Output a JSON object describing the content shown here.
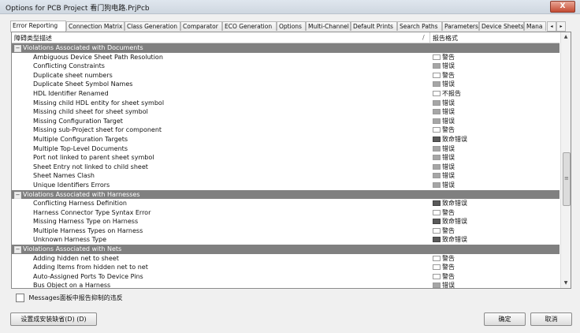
{
  "window": {
    "title": "Options for PCB Project 看门狗电路.PrjPcb",
    "close_label": "X"
  },
  "tabs": [
    "Error Reporting",
    "Connection Matrix",
    "Class Generation",
    "Comparator",
    "ECO Generation",
    "Options",
    "Multi-Channel",
    "Default Prints",
    "Search Paths",
    "Parameters",
    "Device Sheets",
    "Mana"
  ],
  "tab_scroll": {
    "left": "◂",
    "right": "▸"
  },
  "table": {
    "col1": "障碍类型描述",
    "sort_glyph": "/",
    "col2": "报告格式",
    "groups": [
      {
        "name": "Violations Associated with Documents",
        "expander": "−",
        "items": [
          {
            "label": "Ambiguous Device Sheet Path Resolution",
            "level": "警告",
            "kind": "warning"
          },
          {
            "label": "Conflicting Constraints",
            "level": "错误",
            "kind": "error"
          },
          {
            "label": "Duplicate sheet numbers",
            "level": "警告",
            "kind": "warning"
          },
          {
            "label": "Duplicate Sheet Symbol Names",
            "level": "错误",
            "kind": "error"
          },
          {
            "label": "HDL Identifier Renamed",
            "level": "不报告",
            "kind": "none"
          },
          {
            "label": "Missing child HDL entity for sheet symbol",
            "level": "错误",
            "kind": "error"
          },
          {
            "label": "Missing child sheet for sheet symbol",
            "level": "错误",
            "kind": "error"
          },
          {
            "label": "Missing Configuration Target",
            "level": "错误",
            "kind": "error"
          },
          {
            "label": "Missing sub-Project sheet for component",
            "level": "警告",
            "kind": "warning"
          },
          {
            "label": "Multiple Configuration Targets",
            "level": "致命错误",
            "kind": "fatal"
          },
          {
            "label": "Multiple Top-Level Documents",
            "level": "错误",
            "kind": "error"
          },
          {
            "label": "Port not linked to parent sheet symbol",
            "level": "错误",
            "kind": "error"
          },
          {
            "label": "Sheet Entry not linked to child sheet",
            "level": "错误",
            "kind": "error"
          },
          {
            "label": "Sheet Names Clash",
            "level": "错误",
            "kind": "error"
          },
          {
            "label": "Unique Identifiers Errors",
            "level": "错误",
            "kind": "error"
          }
        ]
      },
      {
        "name": "Violations Associated with Harnesses",
        "expander": "−",
        "items": [
          {
            "label": "Conflicting Harness Definition",
            "level": "致命错误",
            "kind": "fatal"
          },
          {
            "label": "Harness Connector Type Syntax Error",
            "level": "警告",
            "kind": "warning"
          },
          {
            "label": "Missing Harness Type on Harness",
            "level": "致命错误",
            "kind": "fatal"
          },
          {
            "label": "Multiple Harness Types on Harness",
            "level": "警告",
            "kind": "warning"
          },
          {
            "label": "Unknown Harness Type",
            "level": "致命错误",
            "kind": "fatal"
          }
        ]
      },
      {
        "name": "Violations Associated with Nets",
        "expander": "−",
        "items": [
          {
            "label": "Adding hidden net to sheet",
            "level": "警告",
            "kind": "warning"
          },
          {
            "label": "Adding Items from hidden net to net",
            "level": "警告",
            "kind": "warning"
          },
          {
            "label": "Auto-Assigned Ports To Device Pins",
            "level": "警告",
            "kind": "warning"
          },
          {
            "label": "Bus Object on a Harness",
            "level": "错误",
            "kind": "error"
          }
        ]
      }
    ]
  },
  "scrollbar": {
    "up": "▲",
    "down": "▼",
    "grip": "≡"
  },
  "checkbox": {
    "label": "Messages面板中报告抑制的违反"
  },
  "buttons": {
    "defaults": "设置成安装缺省(D) (D)",
    "ok": "确定",
    "cancel": "取消"
  }
}
